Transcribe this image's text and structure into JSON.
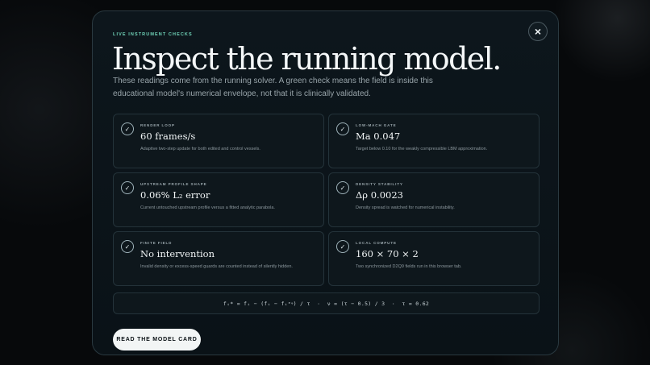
{
  "modal": {
    "close_icon": "×",
    "eyebrow": "LIVE INSTRUMENT CHECKS",
    "title": "Inspect the running model.",
    "lede": "These readings come from the running solver. A green check means the field is inside this educational model's numerical envelope, not that it is clinically validated."
  },
  "checks": [
    {
      "icon": "check-icon",
      "label": "RENDER LOOP",
      "value": "60 frames/s",
      "desc": "Adaptive two-step update for both edited and control vessels."
    },
    {
      "icon": "check-icon",
      "label": "LOW-MACH GATE",
      "value": "Ma 0.047",
      "desc": "Target below 0.10 for the weakly compressible LBM approximation."
    },
    {
      "icon": "check-icon",
      "label": "UPSTREAM PROFILE SHAPE",
      "value": "0.06% L₂ error",
      "desc": "Current untouched upstream profile versus a fitted analytic parabola."
    },
    {
      "icon": "check-icon",
      "label": "DENSITY STABILITY",
      "value": "Δρ 0.0023",
      "desc": "Density spread is watched for numerical instability."
    },
    {
      "icon": "check-icon",
      "label": "FINITE FIELD",
      "value": "No intervention",
      "desc": "Invalid density or excess-speed guards are counted instead of silently hidden."
    },
    {
      "icon": "check-icon",
      "label": "LOCAL COMPUTE",
      "value": "160 × 70 × 2",
      "desc": "Two synchronized D2Q9 fields run in this browser tab."
    }
  ],
  "formula": "fᵢ* = fᵢ − (fᵢ − fᵢᵉᵠ) / τ  ·  ν = (τ − 0.5) / 3  ·  τ = 0.62",
  "cta_label": "READ THE MODEL CARD",
  "colors": {
    "accent": "#6fd3b8",
    "card_bg": "#0e171c",
    "card_border": "#24333a",
    "cta_bg": "#f2f5f5"
  }
}
